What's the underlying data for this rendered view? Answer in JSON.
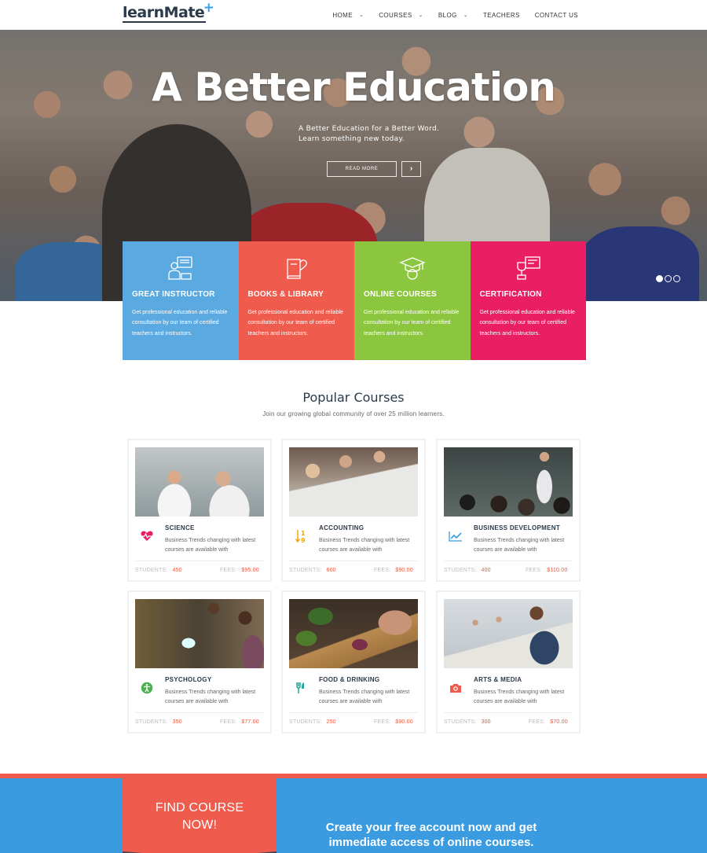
{
  "header": {
    "logo": "learnMate",
    "nav": [
      {
        "label": "HOME",
        "has_dropdown": true
      },
      {
        "label": "COURSES",
        "has_dropdown": true
      },
      {
        "label": "BLOG",
        "has_dropdown": true
      },
      {
        "label": "TEACHERS",
        "has_dropdown": false
      },
      {
        "label": "CONTACT US",
        "has_dropdown": false
      }
    ]
  },
  "hero": {
    "title": "A Better Education",
    "subtitle_line1": "A Better Education for a Better Word.",
    "subtitle_line2": "Learn something new today.",
    "button": "READ MORE",
    "arrow_icon": "chevron-right-icon",
    "slides": 3,
    "active_slide": 1
  },
  "features": [
    {
      "title": "GREAT INSTRUCTOR",
      "text": "Get professional education and reliable consultation by our team of certified teachers and instructors.",
      "color": "#5aa9e0",
      "icon": "instructor-icon"
    },
    {
      "title": "BOOKS & LIBRARY",
      "text": "Get professional education and reliable consultation by our team of certified teachers and instructors.",
      "color": "#ef5b4d",
      "icon": "book-heart-icon"
    },
    {
      "title": "ONLINE COURSES",
      "text": "Get professional education and reliable consultation by our team of certified teachers and instructors.",
      "color": "#8cc63f",
      "icon": "graduation-cap-icon"
    },
    {
      "title": "CERTIFICATION",
      "text": "Get professional education and reliable consultation by our team of certified teachers and instructors.",
      "color": "#e91e63",
      "icon": "trophy-certificate-icon"
    }
  ],
  "popular": {
    "title": "Popular Courses",
    "subtitle": "Join our growing global community of over 25 million learners."
  },
  "courses": [
    {
      "title": "SCIENCE",
      "desc": "Business Trends changing with latest courses are available with",
      "students_label": "STUDENTS:",
      "students": "450",
      "fees_label": "FEES:",
      "fees": "$95.00",
      "icon": "heartbeat-icon",
      "icon_color": "#e91e63"
    },
    {
      "title": "ACCOUNTING",
      "desc": "Business Trends changing with latest courses are available with",
      "students_label": "STUDENTS:",
      "students": "600",
      "fees_label": "FEES:",
      "fees": "$90.00",
      "icon": "sort-numeric-icon",
      "icon_color": "#f0a500"
    },
    {
      "title": "BUSINESS DEVELOPMENT",
      "desc": "Business Trends changing with latest courses are available with",
      "students_label": "STUDENTS:",
      "students": "400",
      "fees_label": "FEES:",
      "fees": "$110.00",
      "icon": "line-chart-icon",
      "icon_color": "#3a9be0"
    },
    {
      "title": "PSYCHOLOGY",
      "desc": "Business Trends changing with latest courses are available with",
      "students_label": "STUDENTS:",
      "students": "350",
      "fees_label": "FEES:",
      "fees": "$77.00",
      "icon": "accessibility-icon",
      "icon_color": "#4caf50"
    },
    {
      "title": "FOOD & DRINKING",
      "desc": "Business Trends changing with latest courses are available with",
      "students_label": "STUDENTS:",
      "students": "250",
      "fees_label": "FEES:",
      "fees": "$90.00",
      "icon": "cutlery-icon",
      "icon_color": "#26a69a"
    },
    {
      "title": "ARTS & MEDIA",
      "desc": "Business Trends changing with latest courses are available with",
      "students_label": "STUDENTS:",
      "students": "300",
      "fees_label": "FEES:",
      "fees": "$70.00",
      "icon": "camera-icon",
      "icon_color": "#ef5b4d"
    }
  ],
  "banner": {
    "find_line1": "FIND COURSE",
    "find_line2": "NOW!",
    "create_line1": "Create your free account now and get",
    "create_line2": "immediate access of online courses."
  }
}
